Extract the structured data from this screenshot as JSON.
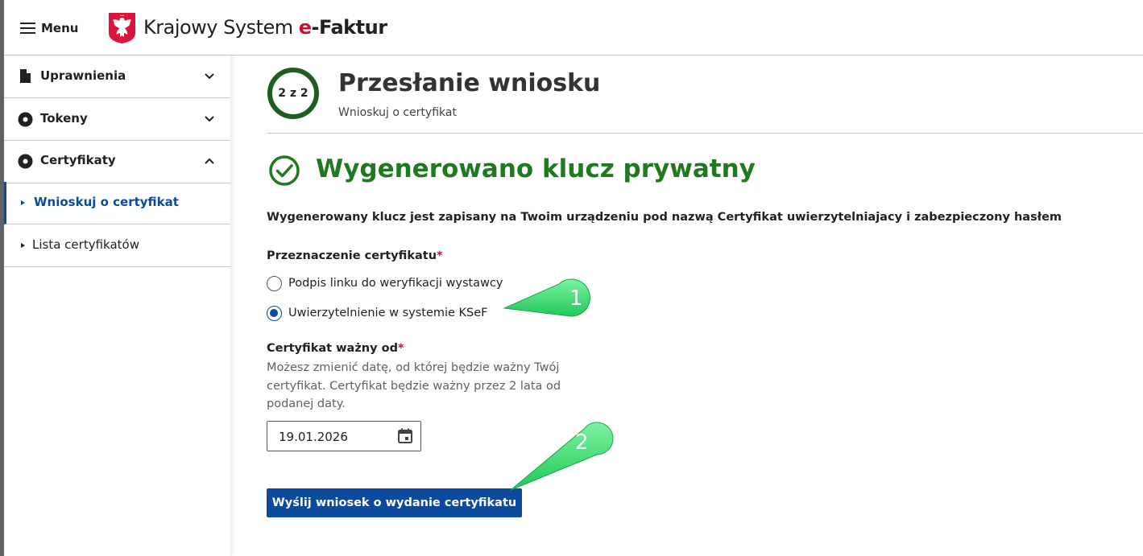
{
  "header": {
    "menu_label": "Menu",
    "brand_prefix": "Krajowy System ",
    "brand_e": "e",
    "brand_suffix": "-Faktur"
  },
  "sidebar": {
    "items": [
      {
        "label": "Uprawnienia",
        "icon": "document-icon",
        "expanded": false
      },
      {
        "label": "Tokeny",
        "icon": "disc-icon",
        "expanded": false
      },
      {
        "label": "Certyfikaty",
        "icon": "disc-icon",
        "expanded": true
      }
    ],
    "subitems": [
      {
        "label": "Wnioskuj o certyfikat",
        "active": true
      },
      {
        "label": "Lista certyfikatów",
        "active": false
      }
    ]
  },
  "main": {
    "step": "2 z 2",
    "title": "Przesłanie wniosku",
    "subtitle": "Wnioskuj o certyfikat",
    "success_title": "Wygenerowano klucz prywatny",
    "info_text": "Wygenerowany klucz jest zapisany na Twoim urządzeniu pod nazwą Certyfikat uwierzytelniajacy i zabezpieczony hasłem",
    "purpose_label": "Przeznaczenie certyfikatu",
    "required_mark": "*",
    "purpose_options": [
      {
        "label": "Podpis linku do weryfikacji wystawcy",
        "checked": false
      },
      {
        "label": "Uwierzytelnienie w systemie KSeF",
        "checked": true
      }
    ],
    "valid_from_label": "Certyfikat ważny od",
    "valid_from_help": "Możesz zmienić datę, od której będzie ważny Twój certyfikat. Certyfikat będzie ważny przez 2 lata od podanej daty.",
    "valid_from_value": "19.01.2026",
    "submit_label": "Wyślij wniosek o wydanie certyfikatu"
  },
  "callouts": [
    "1",
    "2"
  ],
  "colors": {
    "primary": "#0b4a9c",
    "success": "#1f7a1f",
    "required": "#c4102b",
    "callout": "#3ddc6e"
  }
}
